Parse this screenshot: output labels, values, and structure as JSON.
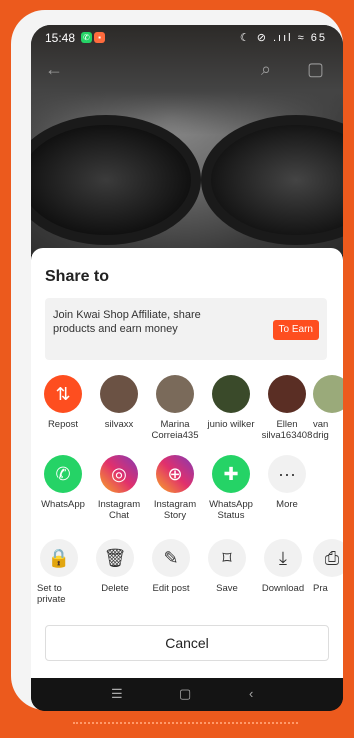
{
  "status": {
    "time": "15:48",
    "right": "☾ ⊘ .ııl ≈ 65"
  },
  "sheet": {
    "title": "Share to",
    "promo": {
      "text": "Join Kwai Shop Affiliate, share products and earn money",
      "button": "To Earn"
    },
    "row1": [
      {
        "label": "Repost"
      },
      {
        "label": "silvaxx"
      },
      {
        "label": "Marina Correia435"
      },
      {
        "label": "junio wilker"
      },
      {
        "label": "Ellen silva163408"
      },
      {
        "label": "van drig"
      }
    ],
    "row2": [
      {
        "label": "WhatsApp"
      },
      {
        "label": "Instagram Chat"
      },
      {
        "label": "Instagram Story"
      },
      {
        "label": "WhatsApp Status"
      },
      {
        "label": "More"
      }
    ],
    "row3": [
      {
        "label": "Set to private"
      },
      {
        "label": "Delete"
      },
      {
        "label": "Edit post"
      },
      {
        "label": "Save"
      },
      {
        "label": "Download"
      },
      {
        "label": "Pra"
      }
    ],
    "cancel": "Cancel"
  },
  "colors": {
    "accent": "#fe4e1f",
    "whatsapp": "#25d366",
    "instagram": "#e1306c"
  },
  "icons": {
    "repost": "repost-icon",
    "whatsapp": "whatsapp-icon",
    "instagram": "instagram-icon",
    "story": "story-plus-icon",
    "status": "status-plus-icon",
    "more": "more-dots-icon",
    "lock": "lock-icon",
    "trash": "trash-icon",
    "edit": "edit-icon",
    "save": "bookmark-icon",
    "download": "download-icon"
  }
}
